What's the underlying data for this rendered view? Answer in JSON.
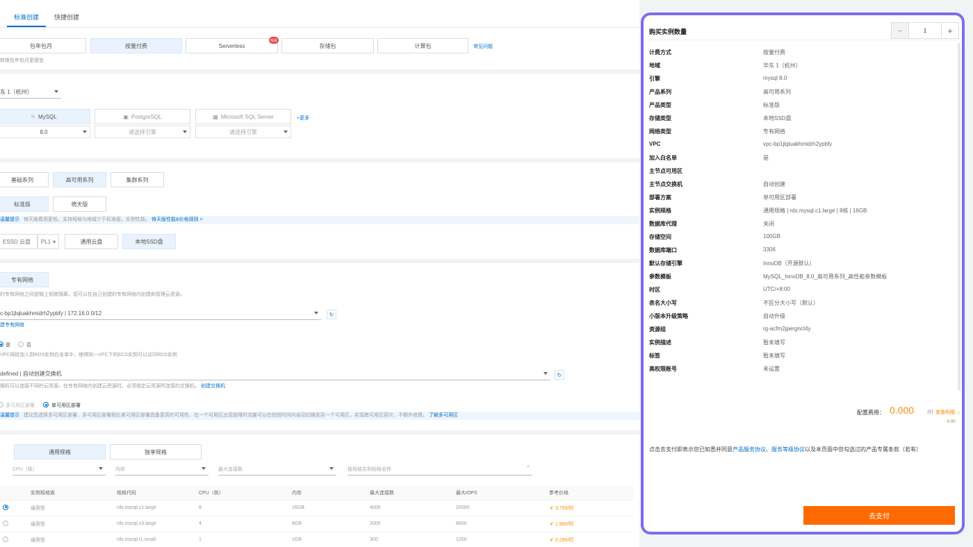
{
  "tabs": [
    "标准创建",
    "快捷创建"
  ],
  "billing": {
    "options": [
      "包年包月",
      "按量付费",
      "Serverless",
      "存储包",
      "计算包"
    ],
    "badge": "惊喜",
    "faq": "常见问题",
    "hint": "转换包年包月更便宜"
  },
  "region": {
    "value": "东 1（杭州）"
  },
  "engine": {
    "items": [
      "MySQL",
      "PostgreSQL",
      "Microsoft SQL Server"
    ],
    "versions": [
      "8.0",
      "请选择引擎",
      "请选择引擎"
    ],
    "more": "+更多"
  },
  "series": {
    "items": [
      "基础系列",
      "高可用系列",
      "集群系列"
    ]
  },
  "edition": {
    "items": [
      "标准版",
      "倚天版"
    ]
  },
  "edition_hint": {
    "prefix": "温馨提示",
    "text": "倚天版费用更低，支持规格与地域少于标准版，实例性能。",
    "link": "倚天版性能&价格规则 >"
  },
  "storage": {
    "cloud": "ESSD 云盘",
    "pl": "PL1",
    "items": [
      "通用云盘",
      "本地SSD盘"
    ]
  },
  "network": {
    "type": "专有网络",
    "desc": "的专有网络之间逻辑上彻底隔离，您可以在自己创建的专有网络内创建和管理云资源。",
    "vpc": "c-bp1jlqluakhmidrh2ypbfy | 172.16.0.0/12",
    "create_vpc": "建专有网络",
    "whitelist_yes": "是",
    "whitelist_no": "否",
    "whitelist_hint": "VPC网段加入到RDS实例白名单中，使得同一VPC下的ECS实例可以访问RDS实例",
    "vswitch": "defined | 自动创建交换机",
    "vswitch_hint": "换机可以连接不同的云资源，在专有网络内创建云资源时，必须指定云资源所连接的交换机。",
    "vswitch_link": "创建交换机",
    "deploy_multi": "多可用区部署",
    "deploy_single": "单可用区部署",
    "deploy_hint_prefix": "温馨提示",
    "deploy_hint": "建议您选择多可用区部署，多可用区部署相比单可用区部署具备更高的可用性，在一个可用区出现故障时流量可以在较短时间内自动切换到另一个可用区，实现跨可用区容灾，不额外收费。",
    "deploy_link": "了解多可用区"
  },
  "spec": {
    "types": [
      "通用规格",
      "独享规格"
    ],
    "filters": [
      "CPU（核）",
      "内存",
      "最大连接数",
      "按规格实例规格名称"
    ],
    "columns": [
      "实例规格族",
      "规格代码",
      "CPU（核）",
      "内存",
      "最大连接数",
      "最大IOPS",
      "参考价格"
    ],
    "rows": [
      [
        "通用型",
        "rds.mysql.c1.large",
        "8",
        "16GB",
        "4000",
        "20000",
        "￥ 3.750/时"
      ],
      [
        "通用型",
        "rds.mysql.s3.large",
        "4",
        "8GB",
        "2000",
        "8000",
        "￥ 1.980/时"
      ],
      [
        "通用型",
        "rds.mysql.t1.small",
        "1",
        "1GB",
        "300",
        "1200",
        "￥ 0.290/时"
      ]
    ]
  },
  "panel": {
    "title": "购买实例数量",
    "quantity": "1",
    "minus": "−",
    "plus": "+",
    "rows": [
      {
        "k": "计费方式",
        "v": "按量付费"
      },
      {
        "k": "地域",
        "v": "华东 1（杭州）"
      },
      {
        "k": "引擎",
        "v": "mysql 8.0"
      },
      {
        "k": "产品系列",
        "v": "高可用系列"
      },
      {
        "k": "产品类型",
        "v": "标准版"
      },
      {
        "k": "存储类型",
        "v": "本地SSD盘"
      },
      {
        "k": "网络类型",
        "v": "专有网络"
      },
      {
        "k": "VPC",
        "v": "vpc-bp1jlqluakhmidrh2ypbfy"
      },
      {
        "k": "加入白名单",
        "v": "是"
      },
      {
        "k": "主节点可用区",
        "v": ""
      },
      {
        "k": "主节点交换机",
        "v": "自动创建"
      },
      {
        "k": "部署方案",
        "v": "单可用区部署"
      },
      {
        "k": "实例规格",
        "v": "通用规格 | rds.mysql.c1.large | 8核 | 16GB"
      },
      {
        "k": "数据库代理",
        "v": "关闭"
      },
      {
        "k": "存储空间",
        "v": "100GB"
      },
      {
        "k": "数据库端口",
        "v": "3306"
      },
      {
        "k": "默认存储引擎",
        "v": "InnoDB（开源默认）"
      },
      {
        "k": "参数模板",
        "v": "MySQL_InnoDB_8.0_高可用系列_高性能参数模板"
      },
      {
        "k": "时区",
        "v": "UTC/+8:00"
      },
      {
        "k": "表名大小写",
        "v": "不区分大小写（默认）"
      },
      {
        "k": "小版本升级策略",
        "v": "自动升级"
      },
      {
        "k": "资源组",
        "v": "rg-acfm2jpergnct4y"
      },
      {
        "k": "实例描述",
        "v": "暂未填写"
      },
      {
        "k": "标签",
        "v": "暂未填写"
      },
      {
        "k": "高权限账号",
        "v": "未设置"
      }
    ],
    "fee_label": "配置费用：",
    "fee_value": "0.000",
    "fee_unit": "/时",
    "fee_detail": "查看明细",
    "fee_sub": "-0.00",
    "agree_prefix": "点击去支付即表示您已知悉并同意",
    "agree_link1": "产品服务协议",
    "agree_sep": "、",
    "agree_link2": "服务等级协议",
    "agree_suffix": "以及本页面中您勾选过的产品专属条款（若有）",
    "pay": "去支付"
  }
}
